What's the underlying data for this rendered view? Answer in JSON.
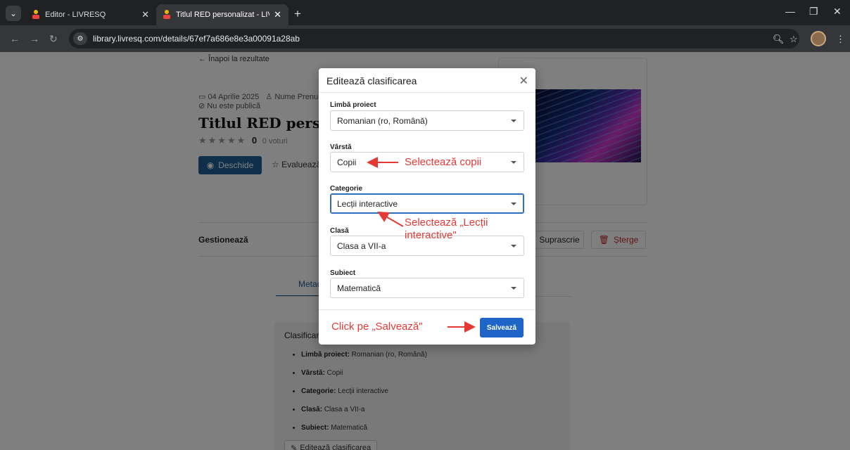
{
  "browser": {
    "tabs": [
      {
        "title": "Editor - LIVRESQ",
        "active": false
      },
      {
        "title": "Titlul RED personalizat - LIVRESQ",
        "active": true
      }
    ],
    "url": "library.livresq.com/details/67ef7a686e8e3a00091a28ab"
  },
  "page": {
    "back_link": "← Înapoi la rezultate",
    "date": "04 Aprilie 2025",
    "author": "Nume Prenume",
    "visibility": "Nu este publică",
    "title": "Titlul RED personalizat",
    "rating_stars": "★★★★★",
    "rating_value": "0",
    "rating_votes": "0 voturi",
    "open_button": "Deschide",
    "rate_button": "Evaluează",
    "manage_label": "Gestionează",
    "overwrite_button": "Suprascrie",
    "delete_button": "Șterge",
    "metadata_tab": "Metadate",
    "classification_title": "Clasificare",
    "classification_items": [
      {
        "label": "Limbă proiect:",
        "value": " Romanian (ro, Română)"
      },
      {
        "label": "Vârstă:",
        "value": " Copii"
      },
      {
        "label": "Categorie:",
        "value": " Lecții interactive"
      },
      {
        "label": "Clasă:",
        "value": " Clasa a VII-a"
      },
      {
        "label": "Subiect:",
        "value": " Matematică"
      }
    ],
    "edit_classification_button": "Editează clasificarea"
  },
  "modal": {
    "title": "Editează clasificarea",
    "fields": {
      "language": {
        "label": "Limbă proiect",
        "value": "Romanian (ro, Română)"
      },
      "age": {
        "label": "Vârstă",
        "value": "Copii"
      },
      "category": {
        "label": "Categorie",
        "value": "Lecții interactive"
      },
      "grade": {
        "label": "Clasă",
        "value": "Clasa a VII-a"
      },
      "subject": {
        "label": "Subiect",
        "value": "Matematică"
      }
    },
    "save_button": "Salvează"
  },
  "annotations": {
    "age_hint": "Selectează copii",
    "category_hint_line1": "Selectează „Lecții",
    "category_hint_line2": "interactive\"",
    "save_hint": "Click pe „Salvează\""
  },
  "colors": {
    "primary": "#1f65c7",
    "annotation": "#e53935",
    "danger": "#c62828"
  }
}
